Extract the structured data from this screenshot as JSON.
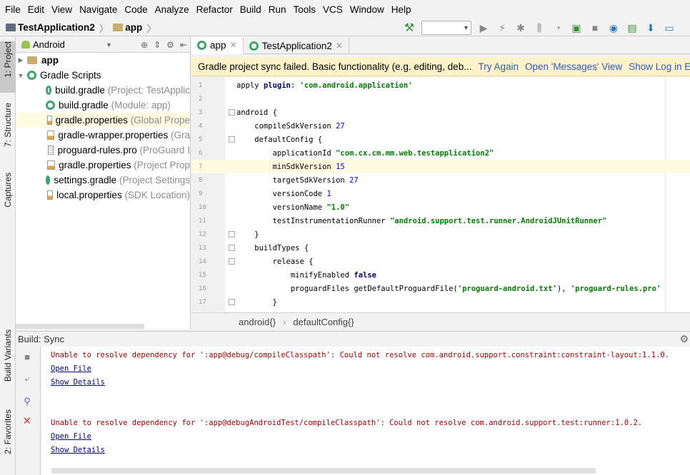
{
  "menubar": {
    "items": [
      "File",
      "Edit",
      "View",
      "Navigate",
      "Code",
      "Analyze",
      "Refactor",
      "Build",
      "Run",
      "Tools",
      "VCS",
      "Window",
      "Help"
    ]
  },
  "breadcrumb": {
    "project": "TestApplication2",
    "module": "app"
  },
  "left_strip": {
    "project": "1: Project",
    "structure": "7: Structure",
    "captures": "Captures",
    "build_variants": "Build Variants",
    "favorites": "2: Favorites"
  },
  "project_panel": {
    "view_mode": "Android",
    "tree": [
      {
        "name": "app",
        "hint": ""
      },
      {
        "name": "Gradle Scripts",
        "hint": ""
      },
      {
        "name": "build.gradle",
        "hint": "(Project: TestApplic"
      },
      {
        "name": "build.gradle",
        "hint": "(Module: app)"
      },
      {
        "name": "gradle.properties",
        "hint": "(Global Prope"
      },
      {
        "name": "gradle-wrapper.properties",
        "hint": "(Gra"
      },
      {
        "name": "proguard-rules.pro",
        "hint": "(ProGuard I"
      },
      {
        "name": "gradle.properties",
        "hint": "(Project Prop"
      },
      {
        "name": "settings.gradle",
        "hint": "(Project Settings"
      },
      {
        "name": "local.properties",
        "hint": "(SDK Location)"
      }
    ]
  },
  "editor_tabs": [
    {
      "label": "app"
    },
    {
      "label": "TestApplication2"
    }
  ],
  "notification": {
    "message": "Gradle project sync failed. Basic functionality (e.g. editing, deb...",
    "try_again": "Try Again",
    "open_messages": "Open 'Messages' View",
    "show_log": "Show Log in Explo"
  },
  "editor": {
    "lines": [
      {
        "n": "1",
        "text": "apply plugin: 'com.android.application'"
      },
      {
        "n": "2",
        "text": ""
      },
      {
        "n": "3",
        "text": "android {"
      },
      {
        "n": "4",
        "text": "    compileSdkVersion 27"
      },
      {
        "n": "5",
        "text": "    defaultConfig {"
      },
      {
        "n": "6",
        "text": "        applicationId \"com.cx.cm.mm.web.testapplication2\""
      },
      {
        "n": "7",
        "text": "        minSdkVersion 15"
      },
      {
        "n": "8",
        "text": "        targetSdkVersion 27"
      },
      {
        "n": "9",
        "text": "        versionCode 1"
      },
      {
        "n": "10",
        "text": "        versionName \"1.0\""
      },
      {
        "n": "11",
        "text": "        testInstrumentationRunner \"android.support.test.runner.AndroidJUnitRunner\""
      },
      {
        "n": "12",
        "text": "    }"
      },
      {
        "n": "13",
        "text": "    buildTypes {"
      },
      {
        "n": "14",
        "text": "        release {"
      },
      {
        "n": "15",
        "text": "            minifyEnabled false"
      },
      {
        "n": "16",
        "text": "            proguardFiles getDefaultProguardFile('proguard-android.txt'), 'proguard-rules.pro'"
      },
      {
        "n": "17",
        "text": "        }"
      }
    ],
    "current_line": "7"
  },
  "editor_breadcrumb": {
    "items": [
      "android{}",
      "defaultConfig{}"
    ]
  },
  "build": {
    "title": "Build: Sync",
    "messages": [
      {
        "error": "Unable to resolve dependency for ':app@debug/compileClasspath': Could not resolve com.android.support.constraint:constraint-layout:1.1.0.",
        "open_file": "Open File",
        "show_details": "Show Details"
      },
      {
        "error": "Unable to resolve dependency for ':app@debugAndroidTest/compileClasspath': Could not resolve com.android.support.test:runner:1.0.2.",
        "open_file": "Open File",
        "show_details": "Show Details"
      }
    ]
  },
  "colors": {
    "accent_link": "#2b58c6",
    "error_text": "#b00000",
    "notification_bg": "#fef3c8",
    "current_line_bg": "#fdfbe0"
  },
  "icons": {
    "hammer": "hammer-icon",
    "run": "run-icon",
    "debug": "debug-icon",
    "sync": "sync-icon",
    "sdk_manager": "sdk-manager-icon"
  }
}
